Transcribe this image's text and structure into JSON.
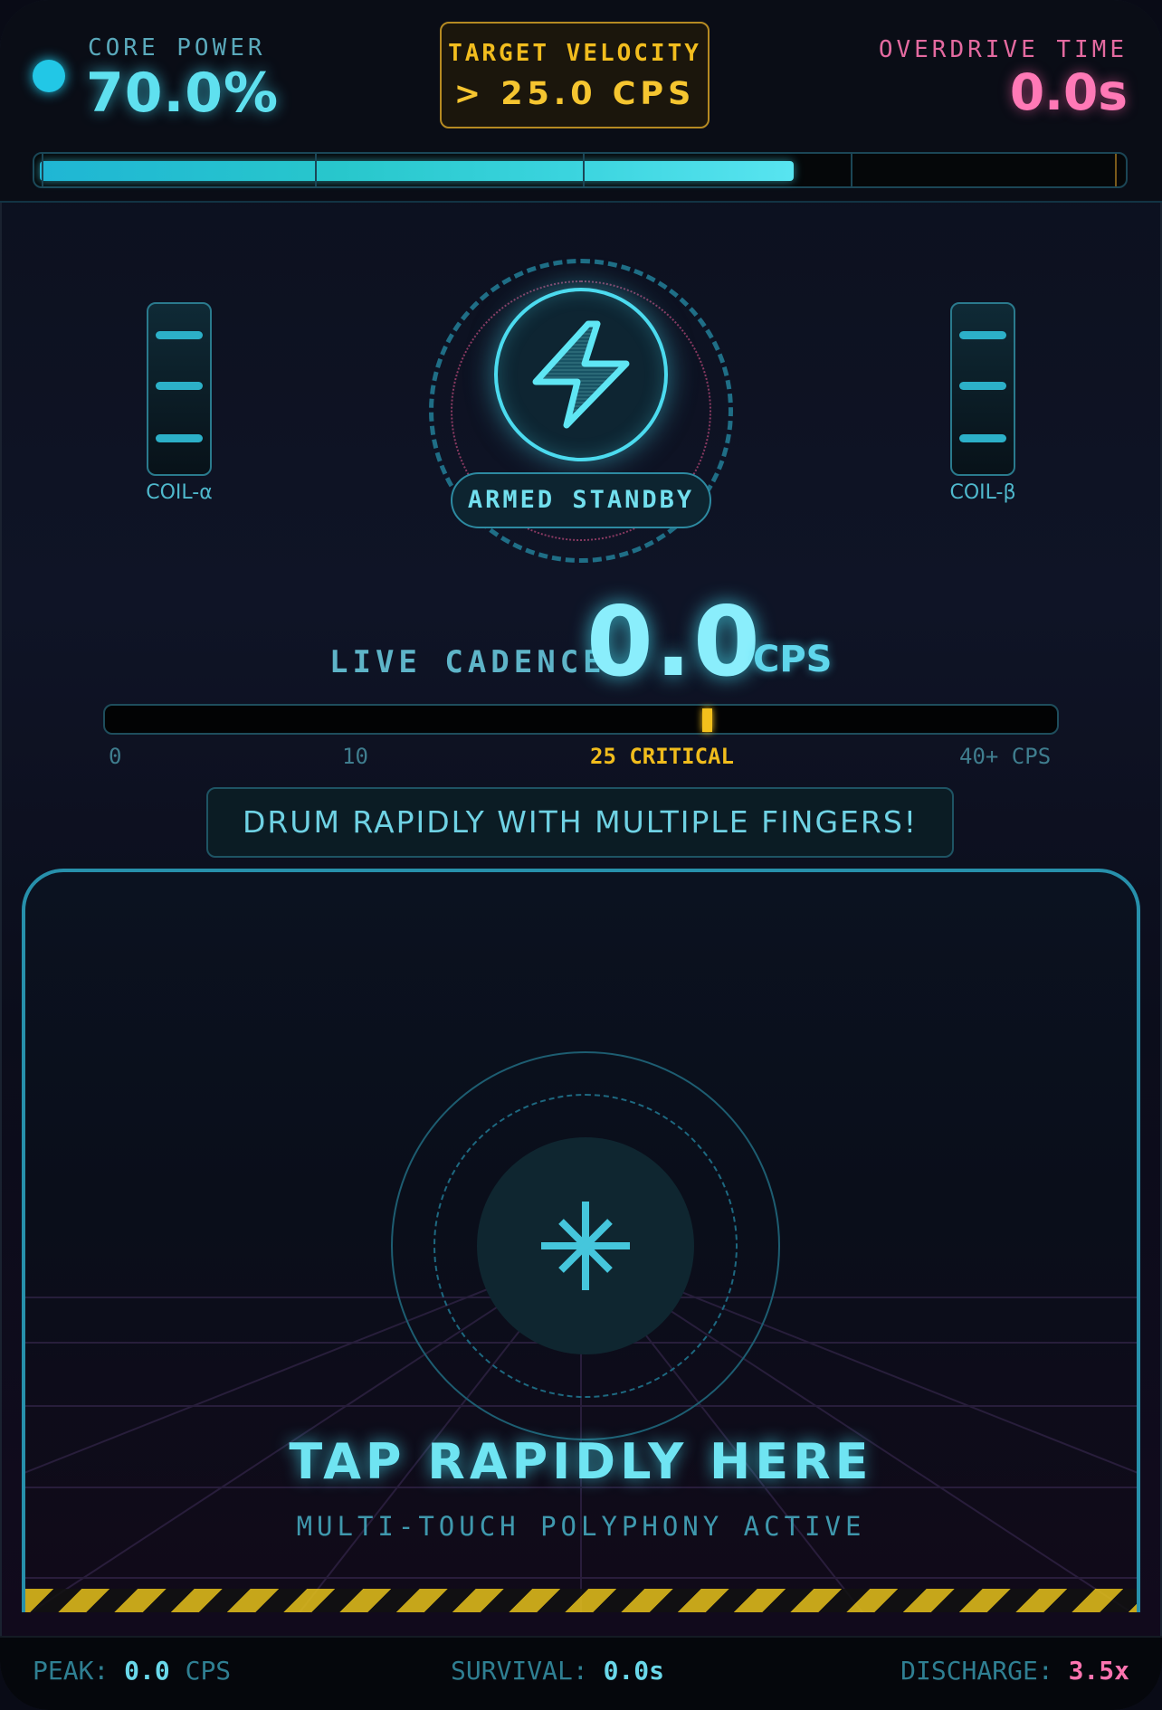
{
  "header": {
    "core_power_label": "CORE POWER",
    "core_power_value": "70.0%",
    "core_power_fraction": 0.7,
    "target_label": "TARGET VELOCITY",
    "target_value": "> 25.0 CPS",
    "overdrive_label": "OVERDRIVE TIME",
    "overdrive_value": "0.0s"
  },
  "reactor": {
    "coil_left_label": "COIL-α",
    "coil_right_label": "COIL-β",
    "status": "ARMED STANDBY",
    "icon": "lightning-bolt-icon"
  },
  "cadence": {
    "label": "LIVE CADENCE",
    "value": "0.0",
    "unit": "CPS",
    "critical_value": 25,
    "scale_labels": [
      "0",
      "10",
      "25 CRITICAL",
      "40+ CPS"
    ]
  },
  "hint": "DRUM RAPIDLY WITH MULTIPLE FINGERS!",
  "tap_zone": {
    "title": "TAP RAPIDLY HERE",
    "subtitle": "MULTI-TOUCH POLYPHONY ACTIVE",
    "icon": "asterisk-icon"
  },
  "footer": {
    "peak_label": "PEAK:",
    "peak_value": "0.0",
    "peak_unit": "CPS",
    "survival_label": "SURVIVAL:",
    "survival_value": "0.0s",
    "discharge_label": "DISCHARGE:",
    "discharge_value": "3.5x"
  },
  "colors": {
    "accent_cyan": "#4cdbef",
    "warning_gold": "#f3c01c",
    "overdrive_pink": "#ff79b6"
  }
}
